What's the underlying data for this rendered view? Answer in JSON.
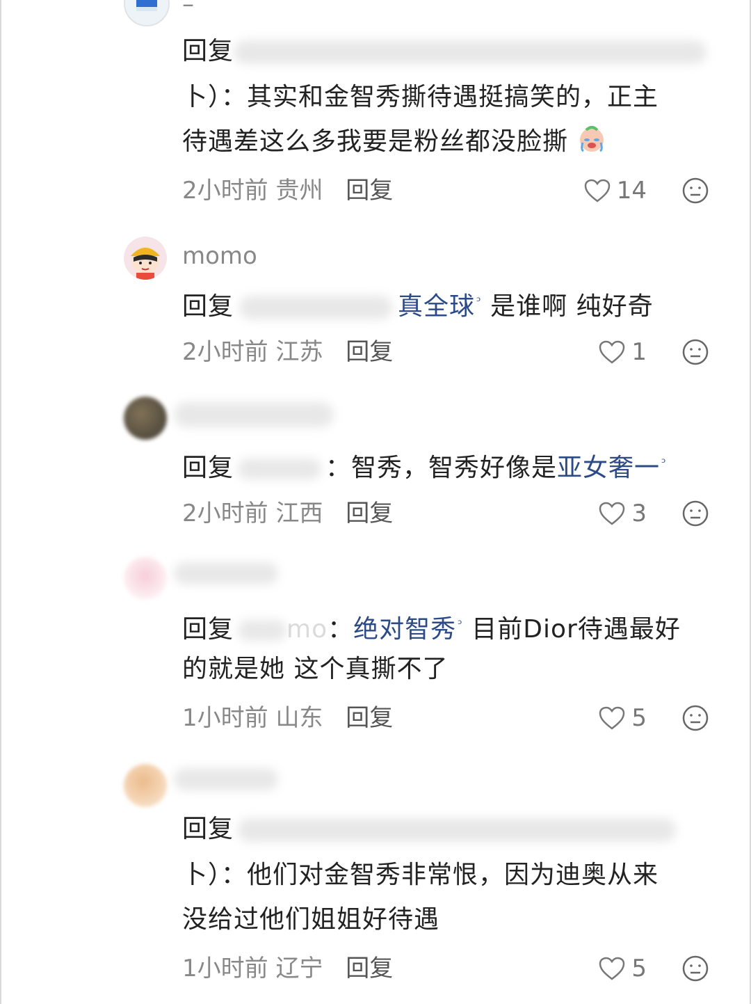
{
  "comments": [
    {
      "username": "–",
      "reply_prefix": "回复",
      "text_lines": [
        "卜）：其实和金智秀撕待遇挺搞笑的，正主",
        "待遇差这么多我要是粉丝都没脸撕"
      ],
      "emoji": "crying-face",
      "time": "2小时前",
      "location": "贵州",
      "reply_label": "回复",
      "likes": "14"
    },
    {
      "username": "momo",
      "reply_prefix": "回复",
      "link_text": "真全球",
      "text_after": "是谁啊 纯好奇",
      "time": "2小时前",
      "location": "江苏",
      "reply_label": "回复",
      "likes": "1"
    },
    {
      "reply_prefix": "回复",
      "text_before": "：智秀，智秀好像是",
      "link_text": "亚女奢一",
      "time": "2小时前",
      "location": "江西",
      "reply_label": "回复",
      "likes": "3"
    },
    {
      "reply_prefix": "回复",
      "partial_name": "mo",
      "link_text": "绝对智秀",
      "text_after": "目前Dior待遇最好",
      "text_line2": "的就是她 这个真撕不了",
      "time": "1小时前",
      "location": "山东",
      "reply_label": "回复",
      "likes": "5"
    },
    {
      "reply_prefix": "回复",
      "text_lines": [
        "卜）：他们对金智秀非常恨，因为迪奥从来",
        "没给过他们姐姐好待遇"
      ],
      "time": "1小时前",
      "location": "辽宁",
      "reply_label": "回复",
      "likes": "5"
    }
  ],
  "colors": {
    "link": "#2b4a86",
    "meta": "#888888",
    "text": "#222222"
  },
  "icons": {
    "like": "heart-outline-icon",
    "reaction": "neutral-face-icon",
    "search": "search-icon"
  }
}
